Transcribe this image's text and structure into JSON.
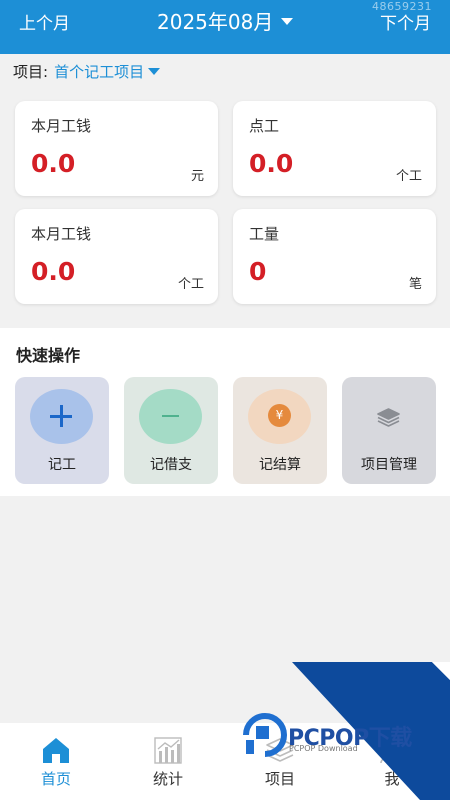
{
  "header": {
    "prev_month": "上个月",
    "month": "2025年08月",
    "next_month": "下个月",
    "id_text": "48659231"
  },
  "project": {
    "label": "项目:",
    "name": "首个记工项目"
  },
  "stats": [
    {
      "title": "本月工钱",
      "value": "0.0",
      "unit": "元"
    },
    {
      "title": "点工",
      "value": "0.0",
      "unit": "个工"
    },
    {
      "title": "本月工钱",
      "value": "0.0",
      "unit": "个工"
    },
    {
      "title": "工量",
      "value": "0",
      "unit": "笔"
    }
  ],
  "quick_ops": {
    "title": "快速操作",
    "items": [
      {
        "label": "记工",
        "icon": "plus-icon"
      },
      {
        "label": "记借支",
        "icon": "minus-icon"
      },
      {
        "label": "记结算",
        "icon": "yuan-icon"
      },
      {
        "label": "项目管理",
        "icon": "layers-icon"
      }
    ]
  },
  "nav": {
    "items": [
      {
        "label": "首页",
        "icon": "home-icon",
        "active": true
      },
      {
        "label": "统计",
        "icon": "chart-icon",
        "active": false
      },
      {
        "label": "项目",
        "icon": "layers-icon",
        "active": false
      },
      {
        "label": "我",
        "icon": "user-icon",
        "active": false
      }
    ]
  },
  "watermark": {
    "brand": "PCPOP下载",
    "sub": "PCPOP Download"
  },
  "colors": {
    "primary": "#1d8fd6",
    "value_red": "#d41f26",
    "watermark_blue": "#0d4a9c"
  }
}
